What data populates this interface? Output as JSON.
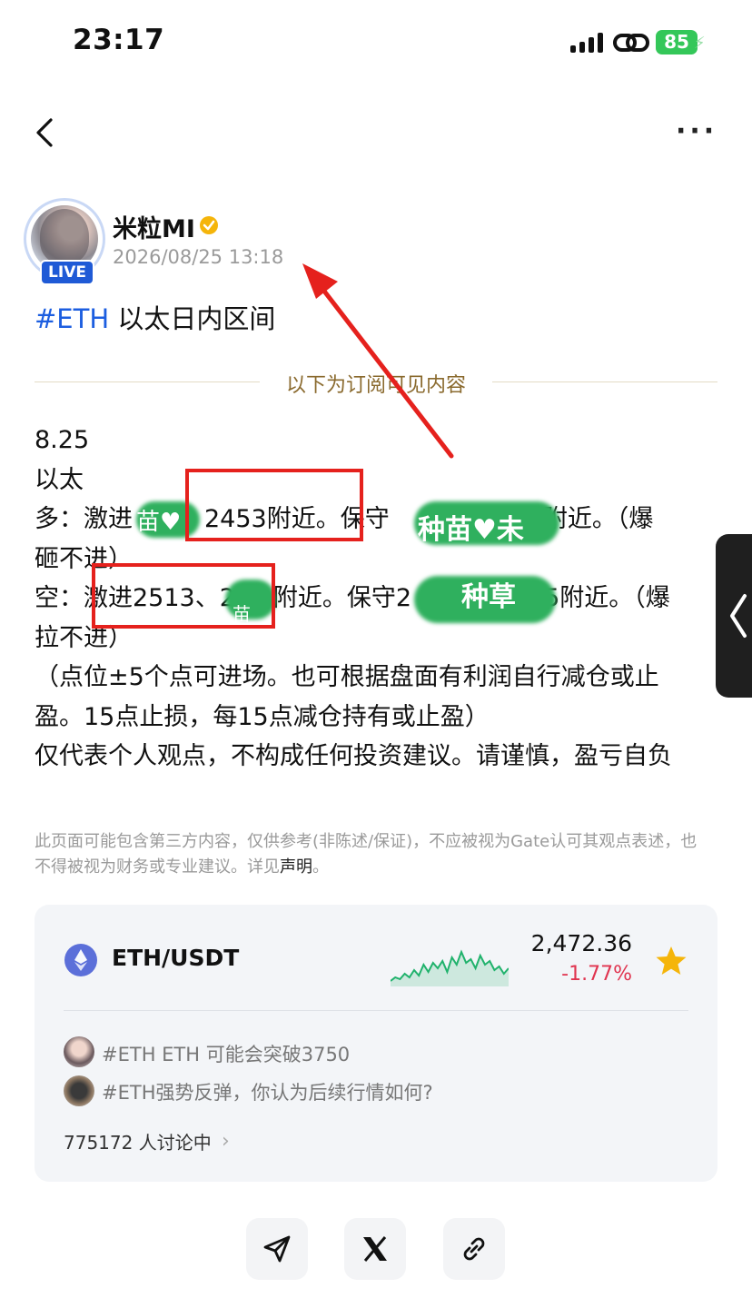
{
  "status": {
    "time": "23:17",
    "battery": "85"
  },
  "author": {
    "name": "米粒MI",
    "badge": "LIVE",
    "timestamp": "2026/08/25 13:18"
  },
  "post": {
    "hashtag": "#ETH",
    "title": " 以太日内区间",
    "divider_label": "以下为订阅可见内容",
    "body": {
      "date": "8.25",
      "asset": "以太",
      "long_prefix": "多：激进",
      "long_mid": "、2453附近。保守",
      "long_suffix": "8附近。（爆",
      "long_cont": "砸不进）",
      "short_prefix": "空：激进2513、2",
      "short_mid": "附近。保守2",
      "short_suffix": "5附近。（爆",
      "short_cont": "拉不进）",
      "note": "（点位±5个点可进场。也可根据盘面有利润自行减仓或止盈。15点止损，每15点减仓持有或止盈）",
      "disclaimer_line": "仅代表个人观点，不构成任何投资建议。请谨慎，盈亏自负"
    },
    "blurred_overlays": [
      "苗♥",
      "种苗♥未",
      "种草",
      "苗"
    ]
  },
  "legal": {
    "text": "此页面可能包含第三方内容，仅供参考(非陈述/保证)，不应被视为Gate认可其观点表述，也不得被视为财务或专业建议。详见",
    "link": "声明",
    "end": "。"
  },
  "market": {
    "pair": "ETH/USDT",
    "price": "2,472.36",
    "change": "-1.77%",
    "colors": {
      "up": "#20b26c",
      "down": "#e0344f",
      "star": "#f5b50a"
    },
    "topics": [
      "#ETH ETH 可能会突破3750",
      "#ETH强势反弹，你认为后续行情如何?"
    ],
    "discussion": "775172 人讨论中",
    "sparkline": [
      48,
      44,
      46,
      40,
      44,
      36,
      42,
      30,
      38,
      28,
      34,
      26,
      38,
      22,
      30,
      16,
      28,
      24,
      34,
      20,
      30,
      26,
      36,
      32,
      40,
      34
    ]
  },
  "icons": [
    "back-icon",
    "more-icon",
    "verified-icon",
    "eth-icon",
    "star-icon",
    "chevron-right-icon",
    "send-icon",
    "x-icon",
    "link-icon",
    "side-handle-chevron-icon"
  ]
}
